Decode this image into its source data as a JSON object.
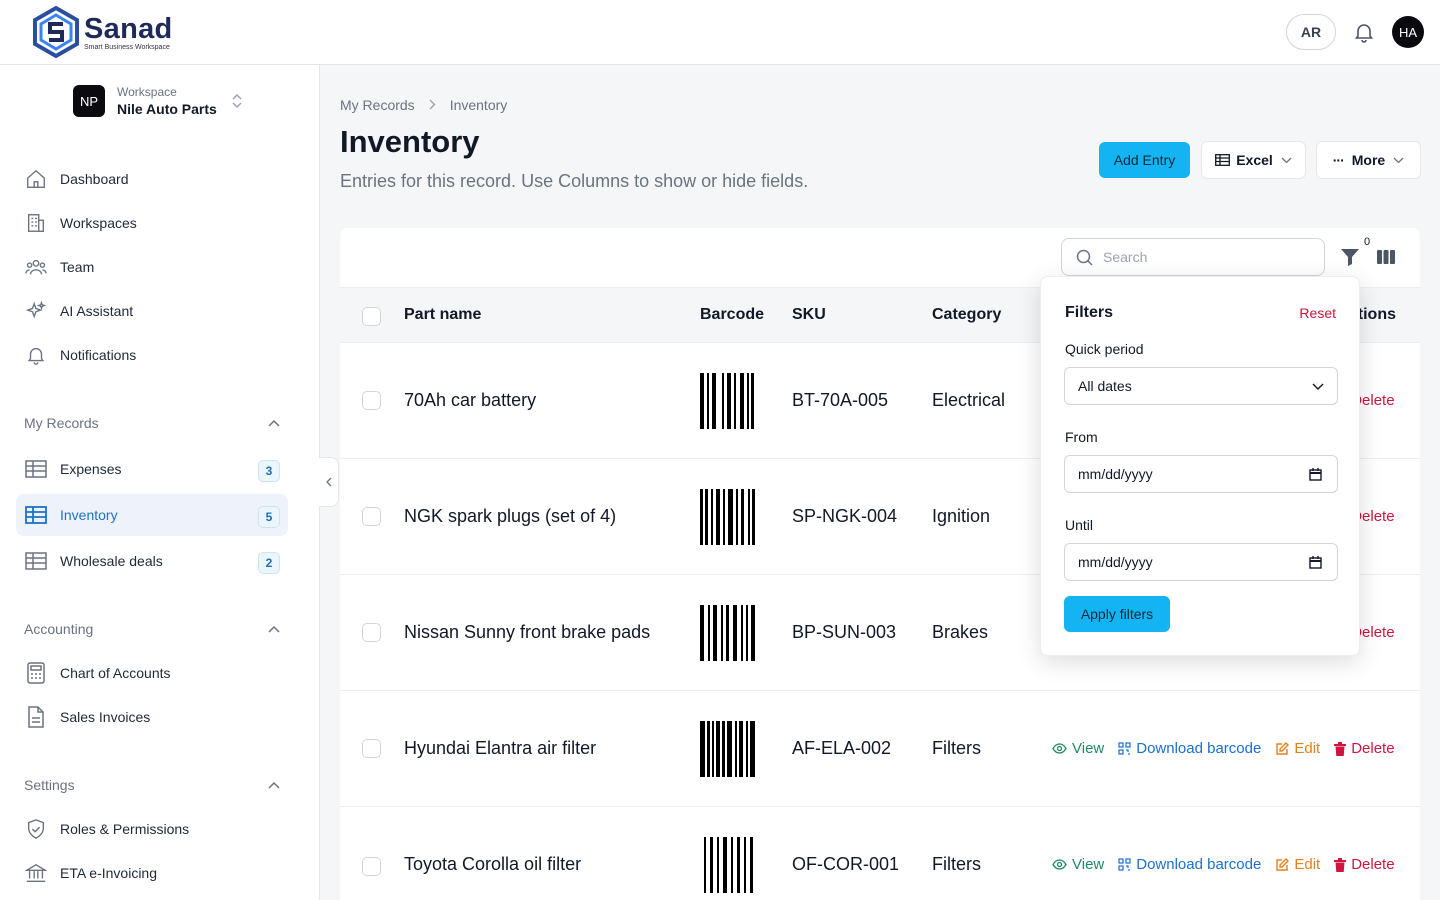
{
  "header": {
    "brand_name": "Sanad",
    "brand_tagline": "Smart Business Workspace",
    "lang_toggle": "AR",
    "user_initials": "HA"
  },
  "workspace": {
    "label": "Workspace",
    "name": "Nile Auto Parts",
    "initials": "NP"
  },
  "sidebar": {
    "main_items": [
      {
        "label": "Dashboard",
        "icon": "home-icon"
      },
      {
        "label": "Workspaces",
        "icon": "building-icon"
      },
      {
        "label": "Team",
        "icon": "users-icon"
      },
      {
        "label": "AI Assistant",
        "icon": "sparkles-icon"
      },
      {
        "label": "Notifications",
        "icon": "bell-icon"
      }
    ],
    "records_section": "My Records",
    "records_items": [
      {
        "label": "Expenses",
        "count": "3"
      },
      {
        "label": "Inventory",
        "count": "5"
      },
      {
        "label": "Wholesale deals",
        "count": "2"
      }
    ],
    "accounting_section": "Accounting",
    "accounting_items": [
      {
        "label": "Chart of Accounts",
        "icon": "calculator-icon"
      },
      {
        "label": "Sales Invoices",
        "icon": "document-icon"
      }
    ],
    "settings_section": "Settings",
    "settings_items": [
      {
        "label": "Roles & Permissions",
        "icon": "shield-icon"
      },
      {
        "label": "ETA e-Invoicing",
        "icon": "bank-icon"
      }
    ]
  },
  "page": {
    "breadcrumb_parent": "My Records",
    "breadcrumb_current": "Inventory",
    "title": "Inventory",
    "subtitle": "Entries for this record. Use Columns to show or hide fields.",
    "add_button": "Add Entry",
    "excel_button": "Excel",
    "more_button": "More"
  },
  "toolbar": {
    "search_placeholder": "Search",
    "filter_count": "0"
  },
  "table": {
    "columns": {
      "part_name": "Part name",
      "barcode": "Barcode",
      "sku": "SKU",
      "category": "Category",
      "actions": "Actions"
    },
    "rows": [
      {
        "name": "70Ah car battery",
        "sku": "BT-70A-005",
        "category": "Electrical"
      },
      {
        "name": "NGK spark plugs (set of 4)",
        "sku": "SP-NGK-004",
        "category": "Ignition"
      },
      {
        "name": "Nissan Sunny front brake pads",
        "sku": "BP-SUN-003",
        "category": "Brakes"
      },
      {
        "name": "Hyundai Elantra air filter",
        "sku": "AF-ELA-002",
        "category": "Filters"
      },
      {
        "name": "Toyota Corolla oil filter",
        "sku": "OF-COR-001",
        "category": "Filters"
      }
    ],
    "action_labels": {
      "view": "View",
      "download": "Download barcode",
      "edit": "Edit",
      "delete": "Delete"
    }
  },
  "filters": {
    "title": "Filters",
    "reset": "Reset",
    "quick_period_label": "Quick period",
    "quick_period_value": "All dates",
    "from_label": "From",
    "from_placeholder": "mm/dd/yyyy",
    "until_label": "Until",
    "until_placeholder": "mm/dd/yyyy",
    "apply": "Apply filters"
  },
  "colors": {
    "accent": "#14b4f2",
    "active_nav": "#1d72c9",
    "danger": "#d1143e",
    "view": "#1d8a66",
    "download": "#1d6fd0",
    "edit": "#e5801b"
  }
}
